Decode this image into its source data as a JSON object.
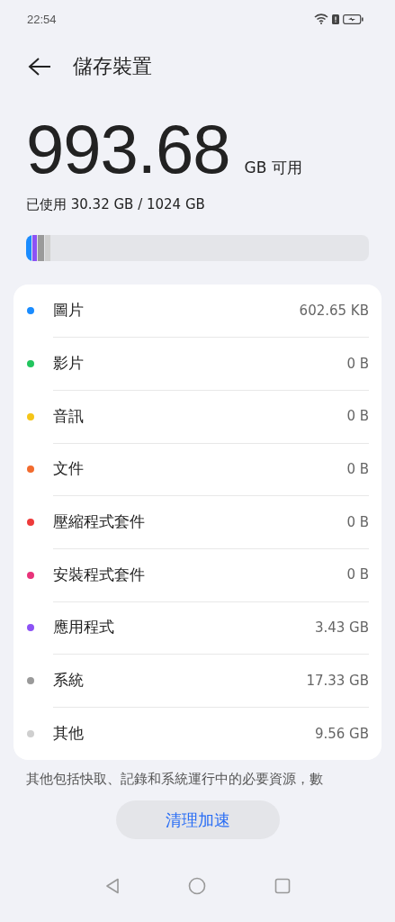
{
  "status_bar": {
    "time": "22:54"
  },
  "header": {
    "title": "儲存裝置"
  },
  "summary": {
    "available": "993.68",
    "unit": "GB 可用",
    "used": "已使用 30.32 GB / 1024 GB"
  },
  "usage_bar": {
    "segments": [
      {
        "level": 0.017,
        "color": "#1a8cff"
      },
      {
        "level": 0.013,
        "color": "#8c52f5"
      },
      {
        "level": 0.018,
        "color": "#9a9a9a"
      },
      {
        "level": 0.016,
        "color": "#cfcfcf"
      }
    ]
  },
  "categories": [
    {
      "label": "圖片",
      "size": "602.65 KB",
      "color": "#1a8cff"
    },
    {
      "label": "影片",
      "size": "0 B",
      "color": "#22c55e"
    },
    {
      "label": "音訊",
      "size": "0 B",
      "color": "#f5c518"
    },
    {
      "label": "文件",
      "size": "0 B",
      "color": "#f26b2e"
    },
    {
      "label": "壓縮程式套件",
      "size": "0 B",
      "color": "#ee3b3b"
    },
    {
      "label": "安裝程式套件",
      "size": "0 B",
      "color": "#e8337a"
    },
    {
      "label": "應用程式",
      "size": "3.43 GB",
      "color": "#8c52f5"
    },
    {
      "label": "系統",
      "size": "17.33 GB",
      "color": "#9a9a9a"
    },
    {
      "label": "其他",
      "size": "9.56 GB",
      "color": "#cfcfcf"
    }
  ],
  "footnote": "其他包括快取、記錄和系統運行中的必要資源，數",
  "action_button": "清理加速"
}
